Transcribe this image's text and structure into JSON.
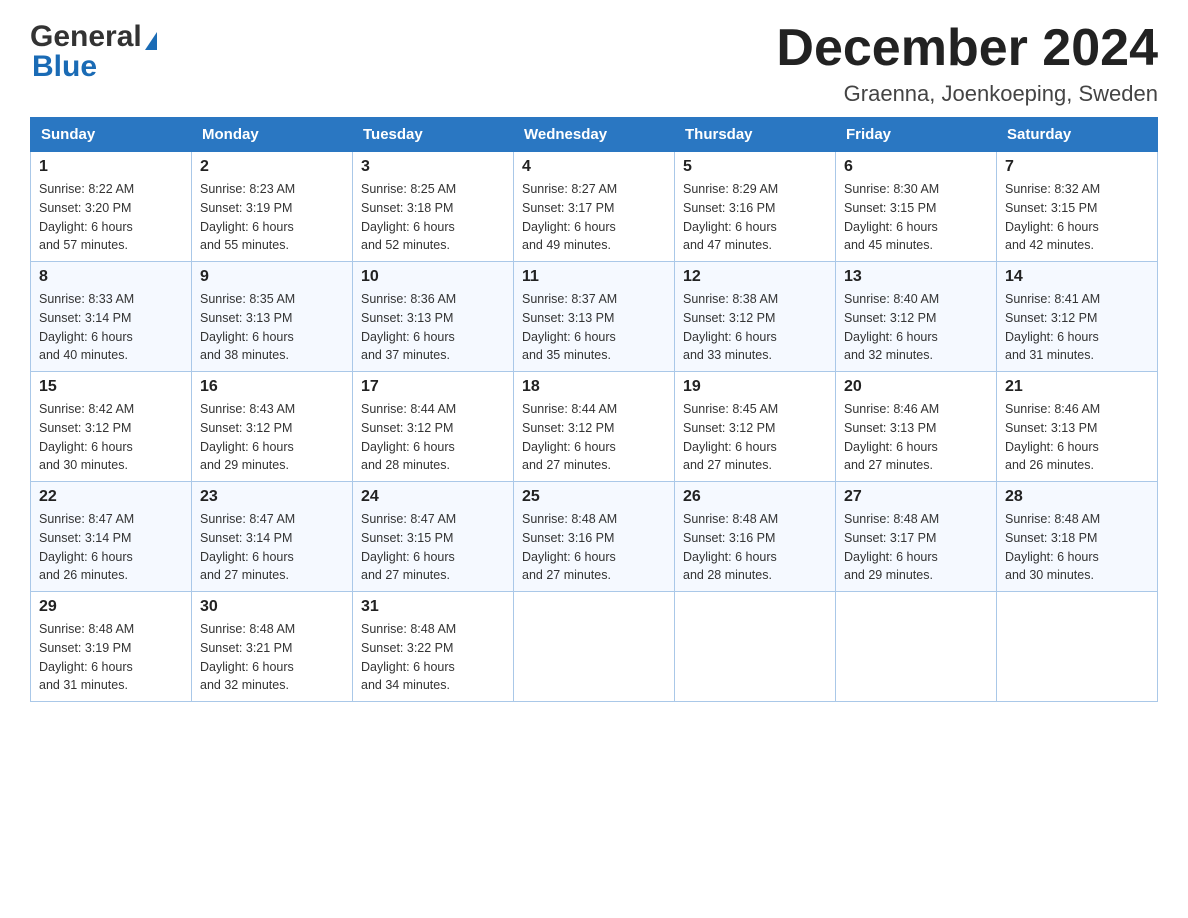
{
  "logo": {
    "general": "General",
    "blue": "Blue",
    "arrow": "▶"
  },
  "title": "December 2024",
  "location": "Graenna, Joenkoeping, Sweden",
  "days_of_week": [
    "Sunday",
    "Monday",
    "Tuesday",
    "Wednesday",
    "Thursday",
    "Friday",
    "Saturday"
  ],
  "weeks": [
    [
      {
        "date": "1",
        "sunrise": "Sunrise: 8:22 AM",
        "sunset": "Sunset: 3:20 PM",
        "daylight": "Daylight: 6 hours",
        "daylight2": "and 57 minutes."
      },
      {
        "date": "2",
        "sunrise": "Sunrise: 8:23 AM",
        "sunset": "Sunset: 3:19 PM",
        "daylight": "Daylight: 6 hours",
        "daylight2": "and 55 minutes."
      },
      {
        "date": "3",
        "sunrise": "Sunrise: 8:25 AM",
        "sunset": "Sunset: 3:18 PM",
        "daylight": "Daylight: 6 hours",
        "daylight2": "and 52 minutes."
      },
      {
        "date": "4",
        "sunrise": "Sunrise: 8:27 AM",
        "sunset": "Sunset: 3:17 PM",
        "daylight": "Daylight: 6 hours",
        "daylight2": "and 49 minutes."
      },
      {
        "date": "5",
        "sunrise": "Sunrise: 8:29 AM",
        "sunset": "Sunset: 3:16 PM",
        "daylight": "Daylight: 6 hours",
        "daylight2": "and 47 minutes."
      },
      {
        "date": "6",
        "sunrise": "Sunrise: 8:30 AM",
        "sunset": "Sunset: 3:15 PM",
        "daylight": "Daylight: 6 hours",
        "daylight2": "and 45 minutes."
      },
      {
        "date": "7",
        "sunrise": "Sunrise: 8:32 AM",
        "sunset": "Sunset: 3:15 PM",
        "daylight": "Daylight: 6 hours",
        "daylight2": "and 42 minutes."
      }
    ],
    [
      {
        "date": "8",
        "sunrise": "Sunrise: 8:33 AM",
        "sunset": "Sunset: 3:14 PM",
        "daylight": "Daylight: 6 hours",
        "daylight2": "and 40 minutes."
      },
      {
        "date": "9",
        "sunrise": "Sunrise: 8:35 AM",
        "sunset": "Sunset: 3:13 PM",
        "daylight": "Daylight: 6 hours",
        "daylight2": "and 38 minutes."
      },
      {
        "date": "10",
        "sunrise": "Sunrise: 8:36 AM",
        "sunset": "Sunset: 3:13 PM",
        "daylight": "Daylight: 6 hours",
        "daylight2": "and 37 minutes."
      },
      {
        "date": "11",
        "sunrise": "Sunrise: 8:37 AM",
        "sunset": "Sunset: 3:13 PM",
        "daylight": "Daylight: 6 hours",
        "daylight2": "and 35 minutes."
      },
      {
        "date": "12",
        "sunrise": "Sunrise: 8:38 AM",
        "sunset": "Sunset: 3:12 PM",
        "daylight": "Daylight: 6 hours",
        "daylight2": "and 33 minutes."
      },
      {
        "date": "13",
        "sunrise": "Sunrise: 8:40 AM",
        "sunset": "Sunset: 3:12 PM",
        "daylight": "Daylight: 6 hours",
        "daylight2": "and 32 minutes."
      },
      {
        "date": "14",
        "sunrise": "Sunrise: 8:41 AM",
        "sunset": "Sunset: 3:12 PM",
        "daylight": "Daylight: 6 hours",
        "daylight2": "and 31 minutes."
      }
    ],
    [
      {
        "date": "15",
        "sunrise": "Sunrise: 8:42 AM",
        "sunset": "Sunset: 3:12 PM",
        "daylight": "Daylight: 6 hours",
        "daylight2": "and 30 minutes."
      },
      {
        "date": "16",
        "sunrise": "Sunrise: 8:43 AM",
        "sunset": "Sunset: 3:12 PM",
        "daylight": "Daylight: 6 hours",
        "daylight2": "and 29 minutes."
      },
      {
        "date": "17",
        "sunrise": "Sunrise: 8:44 AM",
        "sunset": "Sunset: 3:12 PM",
        "daylight": "Daylight: 6 hours",
        "daylight2": "and 28 minutes."
      },
      {
        "date": "18",
        "sunrise": "Sunrise: 8:44 AM",
        "sunset": "Sunset: 3:12 PM",
        "daylight": "Daylight: 6 hours",
        "daylight2": "and 27 minutes."
      },
      {
        "date": "19",
        "sunrise": "Sunrise: 8:45 AM",
        "sunset": "Sunset: 3:12 PM",
        "daylight": "Daylight: 6 hours",
        "daylight2": "and 27 minutes."
      },
      {
        "date": "20",
        "sunrise": "Sunrise: 8:46 AM",
        "sunset": "Sunset: 3:13 PM",
        "daylight": "Daylight: 6 hours",
        "daylight2": "and 27 minutes."
      },
      {
        "date": "21",
        "sunrise": "Sunrise: 8:46 AM",
        "sunset": "Sunset: 3:13 PM",
        "daylight": "Daylight: 6 hours",
        "daylight2": "and 26 minutes."
      }
    ],
    [
      {
        "date": "22",
        "sunrise": "Sunrise: 8:47 AM",
        "sunset": "Sunset: 3:14 PM",
        "daylight": "Daylight: 6 hours",
        "daylight2": "and 26 minutes."
      },
      {
        "date": "23",
        "sunrise": "Sunrise: 8:47 AM",
        "sunset": "Sunset: 3:14 PM",
        "daylight": "Daylight: 6 hours",
        "daylight2": "and 27 minutes."
      },
      {
        "date": "24",
        "sunrise": "Sunrise: 8:47 AM",
        "sunset": "Sunset: 3:15 PM",
        "daylight": "Daylight: 6 hours",
        "daylight2": "and 27 minutes."
      },
      {
        "date": "25",
        "sunrise": "Sunrise: 8:48 AM",
        "sunset": "Sunset: 3:16 PM",
        "daylight": "Daylight: 6 hours",
        "daylight2": "and 27 minutes."
      },
      {
        "date": "26",
        "sunrise": "Sunrise: 8:48 AM",
        "sunset": "Sunset: 3:16 PM",
        "daylight": "Daylight: 6 hours",
        "daylight2": "and 28 minutes."
      },
      {
        "date": "27",
        "sunrise": "Sunrise: 8:48 AM",
        "sunset": "Sunset: 3:17 PM",
        "daylight": "Daylight: 6 hours",
        "daylight2": "and 29 minutes."
      },
      {
        "date": "28",
        "sunrise": "Sunrise: 8:48 AM",
        "sunset": "Sunset: 3:18 PM",
        "daylight": "Daylight: 6 hours",
        "daylight2": "and 30 minutes."
      }
    ],
    [
      {
        "date": "29",
        "sunrise": "Sunrise: 8:48 AM",
        "sunset": "Sunset: 3:19 PM",
        "daylight": "Daylight: 6 hours",
        "daylight2": "and 31 minutes."
      },
      {
        "date": "30",
        "sunrise": "Sunrise: 8:48 AM",
        "sunset": "Sunset: 3:21 PM",
        "daylight": "Daylight: 6 hours",
        "daylight2": "and 32 minutes."
      },
      {
        "date": "31",
        "sunrise": "Sunrise: 8:48 AM",
        "sunset": "Sunset: 3:22 PM",
        "daylight": "Daylight: 6 hours",
        "daylight2": "and 34 minutes."
      },
      null,
      null,
      null,
      null
    ]
  ]
}
